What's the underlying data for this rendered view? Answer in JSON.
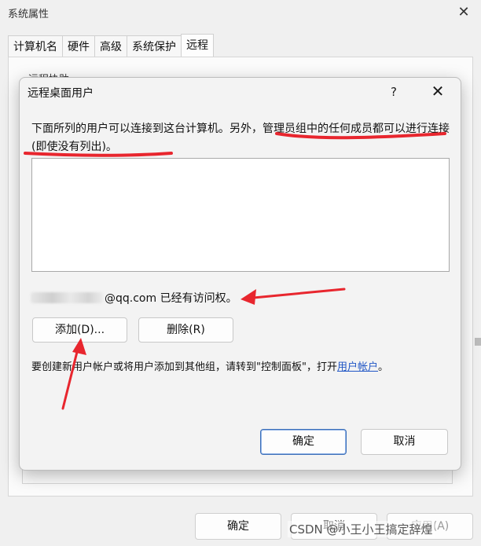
{
  "background_window": {
    "title": "系统属性",
    "close_glyph": "✕",
    "tabs": [
      {
        "label": "计算机名",
        "active": false
      },
      {
        "label": "硬件",
        "active": false
      },
      {
        "label": "高级",
        "active": false
      },
      {
        "label": "系统保护",
        "active": false
      },
      {
        "label": "远程",
        "active": true
      }
    ],
    "group_label": "远程协助",
    "footer": {
      "ok": "确定",
      "cancel": "取消",
      "apply": "应用(A)"
    }
  },
  "dialog": {
    "title": "远程桌面用户",
    "help_glyph": "?",
    "close_glyph": "✕",
    "description": "下面所列的用户可以连接到这台计算机。另外，管理员组中的任何成员都可以进行连接(即使没有列出)。",
    "user_list": [],
    "access_suffix": "@qq.com 已经有访问权。",
    "buttons": {
      "add": "添加(D)...",
      "remove": "删除(R)"
    },
    "hint_text": "要创建新用户帐户或将用户添加到其他组，请转到\"控制面板\"，打开",
    "hint_link": "用户帐户",
    "hint_end": "。",
    "ok": "确定",
    "cancel": "取消"
  },
  "annotations": {
    "color": "#e8262e"
  },
  "watermark": "CSDN @小王小王搞定辞煌"
}
